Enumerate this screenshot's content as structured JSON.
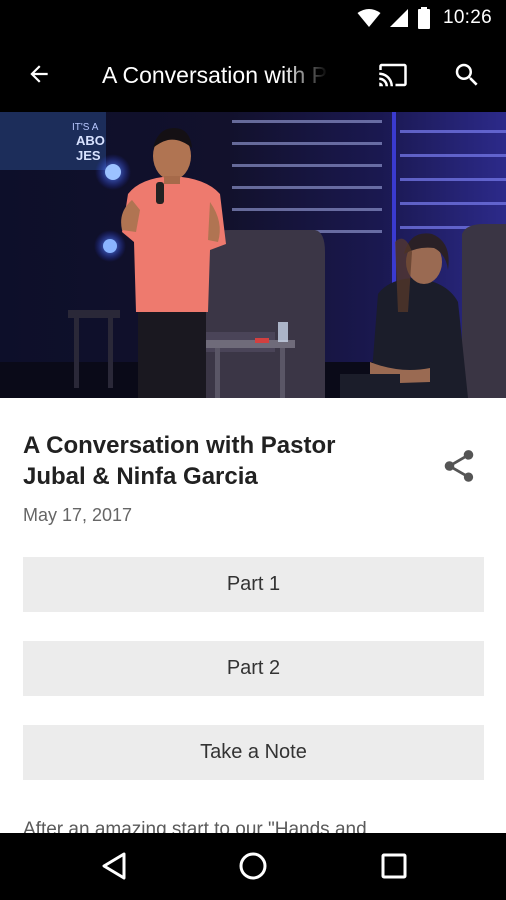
{
  "status_bar": {
    "time": "10:26"
  },
  "app_bar": {
    "title": "A Conversation with Pastor Jubal & Ninfa Garcia"
  },
  "hero": {
    "screen_text": [
      "IT'S A",
      "ABO",
      "JES"
    ]
  },
  "event": {
    "title": "A Conversation with Pastor Jubal & Ninfa Garcia",
    "date": "May 17, 2017"
  },
  "buttons": {
    "part1": "Part 1",
    "part2": "Part 2",
    "take_note": "Take a Note"
  },
  "description": "After an amazing start to our \"Hands and",
  "colors": {
    "bars": "#000000",
    "button_bg": "#ececec",
    "title_text": "#212121"
  }
}
